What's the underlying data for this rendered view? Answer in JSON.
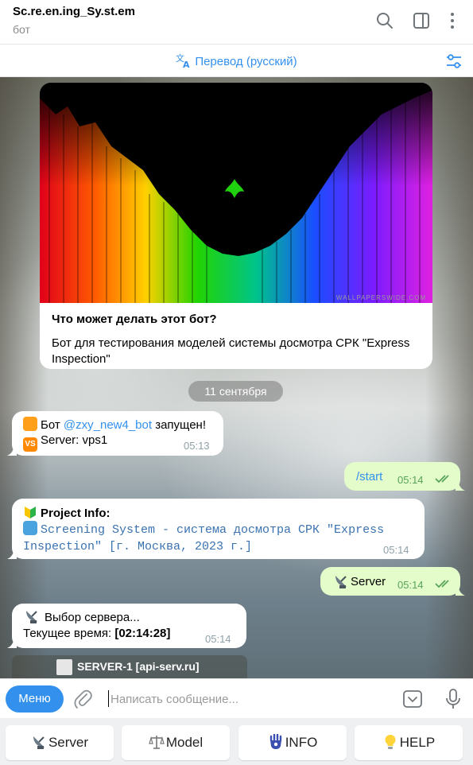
{
  "header": {
    "title": "Sc.re.en.ing_Sy.st.em",
    "subtitle": "бот"
  },
  "translate_bar": {
    "label": "Перевод (русский)"
  },
  "bot_card": {
    "watermark": "WALLPAPERSWIDE.COM",
    "title": "Что может делать этот бот?",
    "description": "Бот для тестирования моделей системы досмотра СРК \"Express Inspection\""
  },
  "date_separator": "11 сентября",
  "messages": {
    "m1": {
      "line1_prefix": "Бот ",
      "line1_link": "@zxy_new4_bot",
      "line1_suffix": " запущен!",
      "line2": "Server: vps1",
      "time": "05:13"
    },
    "m2": {
      "text": "/start",
      "time": "05:14"
    },
    "m3": {
      "heading": "Project Info:",
      "mono_text": "Screening System - система досмотра СРК \"Express Inspection\" [г. Москва, 2023 г.]",
      "time": "05:14"
    },
    "m4": {
      "text": "Server",
      "time": "05:14"
    },
    "m5": {
      "line1": "Выбор сервера...",
      "line2_prefix": "Текущее время: ",
      "line2_bold": "[02:14:28]",
      "time": "05:14"
    }
  },
  "inline_keyboard": {
    "button_label": "SERVER-1 [api-serv.ru]"
  },
  "input_bar": {
    "menu_label": "Меню",
    "placeholder": "Написать сообщение..."
  },
  "reply_keyboard": {
    "buttons": [
      "Server",
      "Model",
      "INFO",
      "HELP"
    ]
  },
  "colors": {
    "accent": "#3390ec",
    "outgoing_bubble": "#e3fcc9",
    "incoming_bubble": "#ffffff",
    "read_checks": "#58a45a"
  }
}
